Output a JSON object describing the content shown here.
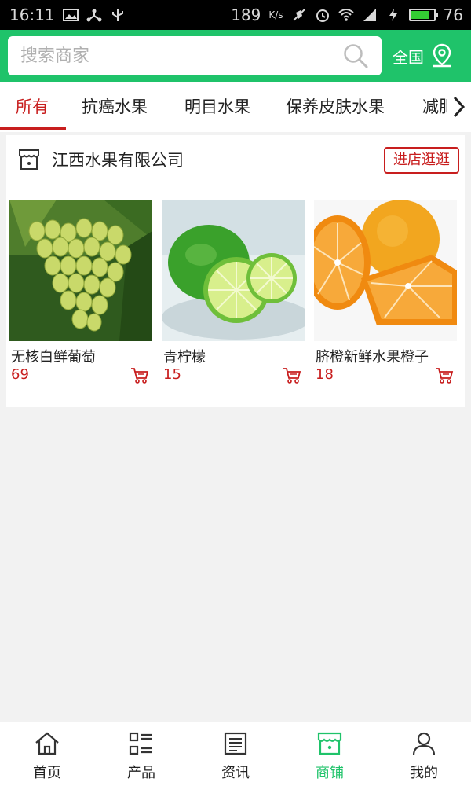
{
  "status_bar": {
    "time": "16:11",
    "speed": "189",
    "speed_unit": "K/s",
    "battery": "76"
  },
  "search": {
    "placeholder": "搜索商家",
    "region_label": "全国"
  },
  "tabs": [
    {
      "label": "所有",
      "active": true
    },
    {
      "label": "抗癌水果",
      "active": false
    },
    {
      "label": "明目水果",
      "active": false
    },
    {
      "label": "保养皮肤水果",
      "active": false
    },
    {
      "label": "减肥",
      "active": false
    }
  ],
  "shop": {
    "name": "江西水果有限公司",
    "visit_label": "进店逛逛",
    "products": [
      {
        "name": "无核白鲜葡萄",
        "price": "69"
      },
      {
        "name": "青柠檬",
        "price": "15"
      },
      {
        "name": "脐橙新鲜水果橙子",
        "price": "18"
      }
    ]
  },
  "bottom_nav": [
    {
      "label": "首页",
      "icon": "home-icon",
      "active": false
    },
    {
      "label": "产品",
      "icon": "list-icon",
      "active": false
    },
    {
      "label": "资讯",
      "icon": "news-icon",
      "active": false
    },
    {
      "label": "商铺",
      "icon": "shop-icon",
      "active": true
    },
    {
      "label": "我的",
      "icon": "user-icon",
      "active": false
    }
  ],
  "colors": {
    "brand_green": "#1fc36a",
    "accent_red": "#c81e1e"
  }
}
